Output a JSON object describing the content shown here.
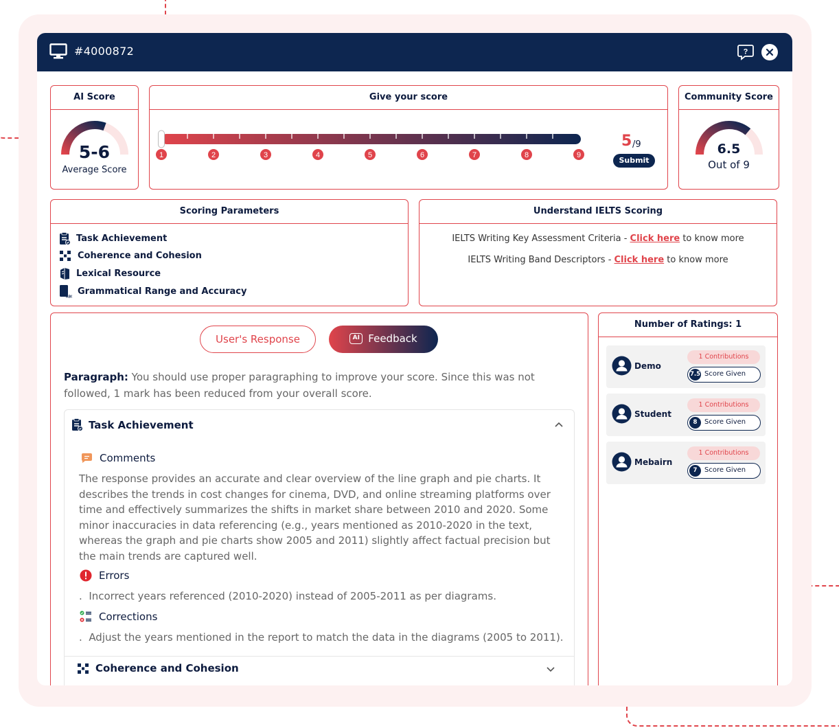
{
  "header": {
    "title": "#4000872"
  },
  "ai_score": {
    "title": "AI Score",
    "value": "5-6",
    "subtitle": "Average Score",
    "fraction": 0.61
  },
  "give_score": {
    "title": "Give your score",
    "ticks": [
      "1",
      "2",
      "3",
      "4",
      "5",
      "6",
      "7",
      "8",
      "9"
    ],
    "current": "5",
    "max": "/9",
    "submit_label": "Submit",
    "slider_value": 1
  },
  "community_score": {
    "title": "Community Score",
    "value": "6.5",
    "subtitle": "Out of 9",
    "fraction": 0.72
  },
  "scoring_parameters": {
    "title": "Scoring Parameters",
    "items": [
      {
        "label": "Task Achievement",
        "icon": "clipboard-check-icon"
      },
      {
        "label": "Coherence and Cohesion",
        "icon": "flow-blocks-icon"
      },
      {
        "label": "Lexical Resource",
        "icon": "books-icon"
      },
      {
        "label": "Grammatical Range and Accuracy",
        "icon": "grammar-book-icon"
      }
    ]
  },
  "understand_ielts": {
    "title": "Understand IELTS Scoring",
    "lines": [
      {
        "prefix": "IELTS Writing Key Assessment Criteria - ",
        "link": "Click here",
        "suffix": " to know more"
      },
      {
        "prefix": "IELTS Writing Band Descriptors - ",
        "link": "Click here",
        "suffix": " to know more"
      }
    ]
  },
  "tabs": {
    "user_response": "User's Response",
    "ai_feedback": "Feedback",
    "ai_badge": "AI"
  },
  "paragraph": {
    "label": "Paragraph:",
    "text": " You should use proper paragraphing to improve your score. Since this was not followed, 1 mark has been reduced from your overall score."
  },
  "task_achievement": {
    "title": "Task Achievement",
    "comments_title": "Comments",
    "comments": "The response provides an accurate and clear overview of the line graph and pie charts. It describes the trends in cost changes for cinema, DVD, and online streaming platforms over time and effectively summarizes the shifts in market share between 2010 and 2020. Some minor inaccuracies in data referencing (e.g., years mentioned as 2010-2020 in the text, whereas the graph and pie charts show 2005 and 2011) slightly affect factual precision but the main trends are captured well.",
    "errors_title": "Errors",
    "errors": [
      "Incorrect years referenced (2010-2020) instead of 2005-2011 as per diagrams."
    ],
    "corrections_title": "Corrections",
    "corrections": [
      "Adjust the years mentioned in the report to match the data in the diagrams (2005 to 2011)."
    ]
  },
  "coherence": {
    "title": "Coherence and Cohesion"
  },
  "ratings": {
    "title": "Number of Ratings: 1",
    "items": [
      {
        "name": "Demo",
        "contributions": "1 Contributions",
        "score": "7.5",
        "given_label": "Score Given"
      },
      {
        "name": "Student",
        "contributions": "1 Contributions",
        "score": "8",
        "given_label": "Score Given"
      },
      {
        "name": "Mebairn",
        "contributions": "1 Contributions",
        "score": "7",
        "given_label": "Score Given"
      }
    ]
  },
  "colors": {
    "navy": "#0d2650",
    "accent": "#e0444b",
    "pink_bg": "#fdf1f1"
  }
}
